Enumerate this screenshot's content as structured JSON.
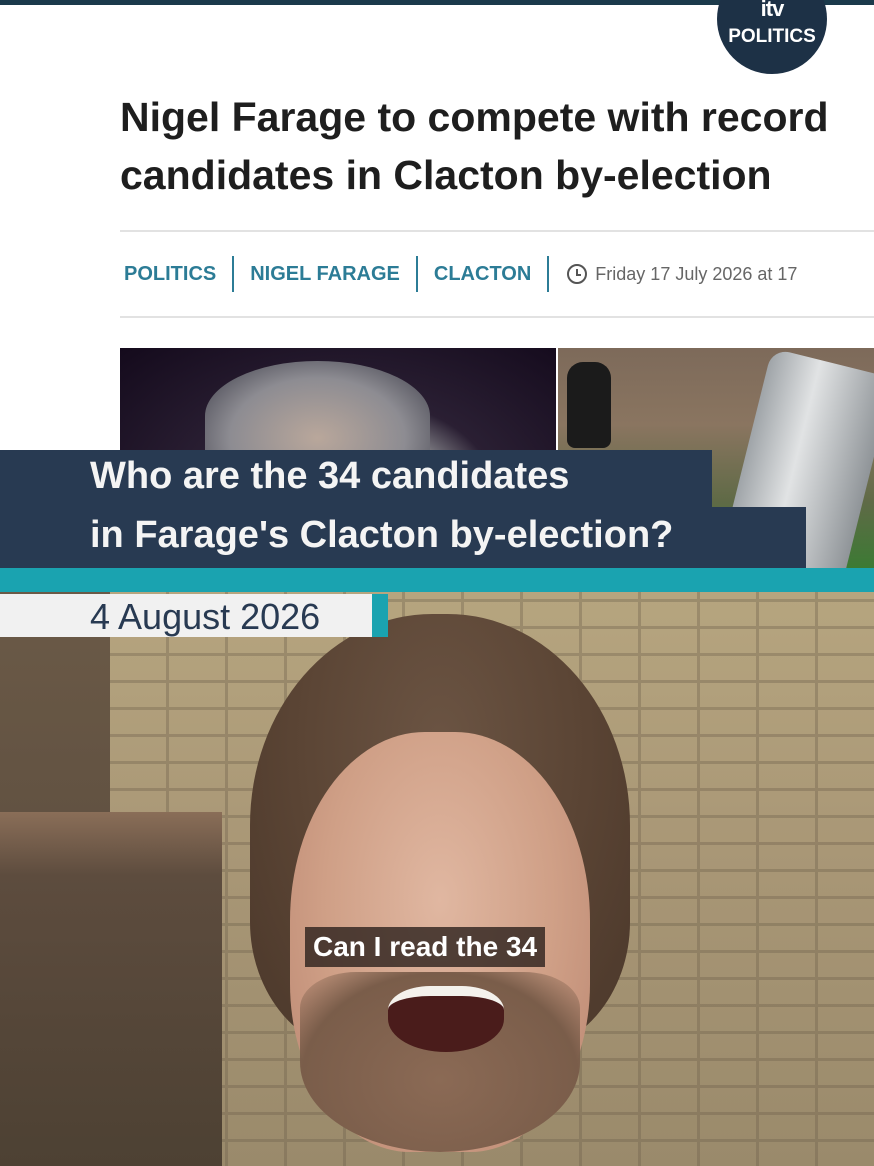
{
  "brand": {
    "logo_mark": "itv",
    "section": "POLITICS"
  },
  "article": {
    "headline_line1": "Nigel Farage to compete with record",
    "headline_line2": "candidates in Clacton by-election",
    "tags": [
      "POLITICS",
      "NIGEL FARAGE",
      "CLACTON"
    ],
    "published": "Friday 17 July 2026 at 17"
  },
  "overlay": {
    "title_line1": "Who are the 34 candidates",
    "title_line2": "in Farage's Clacton by-election?",
    "date": "4 August 2026",
    "caption": "Can I read the 34"
  },
  "colors": {
    "navy": "#283a52",
    "teal": "#1aa3b0",
    "tag_blue": "#2c7c96"
  },
  "icons": {
    "clock": "clock-icon"
  }
}
